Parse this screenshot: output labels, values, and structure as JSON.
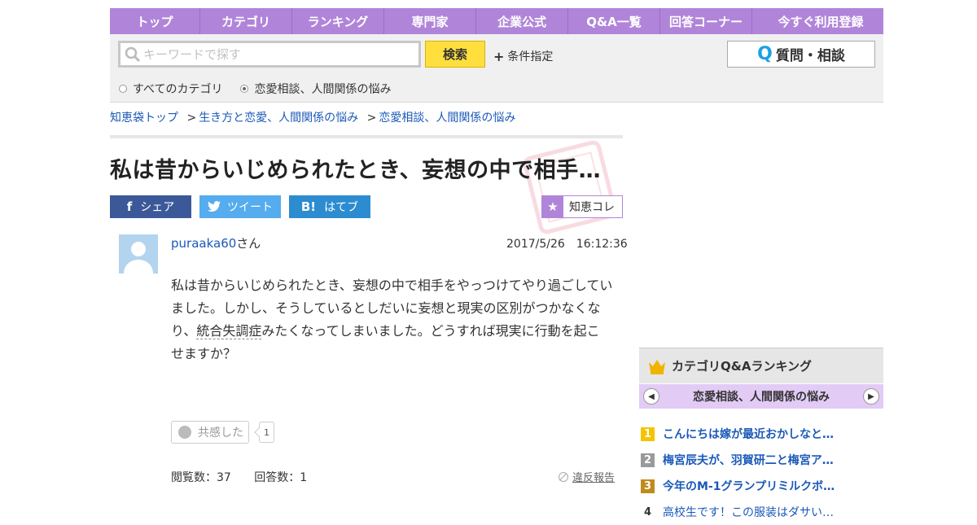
{
  "nav": {
    "items": [
      {
        "label": "トップ",
        "w": 110
      },
      {
        "label": "カテゴリ",
        "w": 112
      },
      {
        "label": "ランキング",
        "w": 112
      },
      {
        "label": "専門家",
        "w": 112
      },
      {
        "label": "企業公式",
        "w": 112
      },
      {
        "label": "Q&A一覧",
        "w": 112
      },
      {
        "label": "回答コーナー",
        "w": 112
      },
      {
        "label": "今すぐ利用登録",
        "w": 168
      }
    ]
  },
  "search": {
    "placeholder": "キーワードで探す",
    "button_label": "検索",
    "conditions_label": "条件指定",
    "radio_all": "すべてのカテゴリ",
    "radio_current": "恋愛相談、人間関係の悩み",
    "ask_button": "質問・相談"
  },
  "breadcrumb": {
    "items": [
      "知恵袋トップ",
      "生き方と恋愛、人間関係の悩み",
      "恋愛相談、人間関係の悩み"
    ],
    "separator": ">"
  },
  "question": {
    "title": "私は昔からいじめられたとき、妄想の中で相手…",
    "user": "puraaka60",
    "user_suffix": "さん",
    "date": "2017/5/26　16:12:36",
    "body_1": "私は昔からいじめられたとき、妄想の中で相手をやっつけてやり過ごしていました。しかし、そうしているとしだいに妄想と現実の区別がつかなくなり、",
    "body_link": "統合失調症",
    "body_2": "みたくなってしまいました。どうすれば現実に行動を起こ",
    "body_3": "せますか？",
    "empathy_label": "共感した",
    "empathy_count": "1",
    "views_label": "閲覧数：37",
    "answers_label": "回答数：1",
    "report_label": "違反報告"
  },
  "share": {
    "facebook": "シェア",
    "twitter": "ツイート",
    "hatena": "はてブ",
    "chiekore": "知恵コレ"
  },
  "ranking": {
    "title": "カテゴリQ&Aランキング",
    "category": "恋愛相談、人間関係の悩み",
    "items": [
      {
        "rank": "1",
        "text": "こんにちは嫁が最近おかしなと…",
        "color": "#f5c400"
      },
      {
        "rank": "2",
        "text": "梅宮辰夫が、羽賀研二と梅宮ア…",
        "color": "#9a9a9a"
      },
      {
        "rank": "3",
        "text": "今年のM-1グランプリミルクボ…",
        "color": "#c08a1e"
      },
      {
        "rank": "4",
        "text": "高校生です！この服装はダサい…",
        "color": ""
      }
    ]
  },
  "colors": {
    "accent": "#b085d9",
    "link": "#1a59b8",
    "search_button": "#ffdf3d"
  }
}
